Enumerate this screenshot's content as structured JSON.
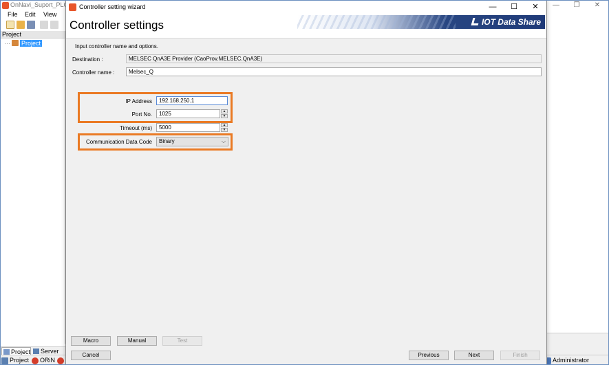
{
  "background_app": {
    "title": "OnNavi_Suport_PLC_t",
    "menu": [
      "File",
      "Edit",
      "View"
    ],
    "project_panel": {
      "header": "Project",
      "tree_item": "Project"
    },
    "tabs": [
      "Project",
      "Server"
    ],
    "status_left": [
      "Project",
      "ORiN"
    ],
    "status_right": "Administrator"
  },
  "dialog": {
    "title": "Controller setting wizard",
    "heading": "Controller settings",
    "brand": "IOT Data Share",
    "instruction": "Input controller name and options.",
    "destination": {
      "label": "Destination :",
      "value": "MELSEC QnA3E Provider (CaoProv.MELSEC.QnA3E)"
    },
    "controller_name": {
      "label": "Controller name :",
      "value": "Melsec_Q"
    },
    "ip_address": {
      "label": "IP Address",
      "value": "192.168.250.1"
    },
    "port": {
      "label": "Port No.",
      "value": "1025"
    },
    "timeout": {
      "label": "Timeout (ms)",
      "value": "5000"
    },
    "comm_code": {
      "label": "Communication Data Code",
      "value": "Binary"
    },
    "buttons": {
      "macro": "Macro",
      "manual": "Manual",
      "test": "Test",
      "cancel": "Cancel",
      "previous": "Previous",
      "next": "Next",
      "finish": "Finish"
    }
  },
  "colors": {
    "highlight": "#ea7a24",
    "brand_dark": "#1f3a78",
    "selection": "#3399ff"
  }
}
